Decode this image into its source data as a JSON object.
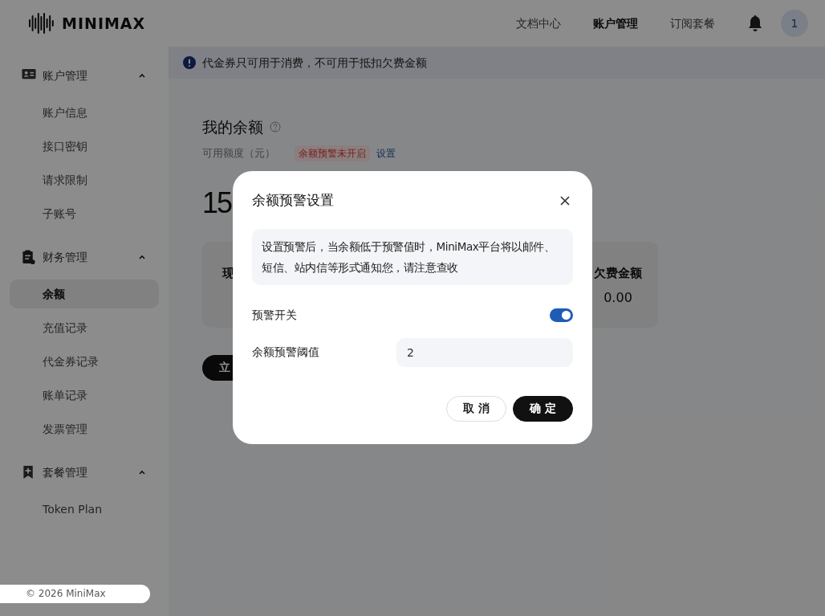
{
  "header": {
    "logo": "MINIMAX",
    "nav": [
      {
        "label": "文档中心",
        "selected": false
      },
      {
        "label": "账户管理",
        "selected": true
      },
      {
        "label": "订阅套餐",
        "selected": false
      }
    ],
    "avatar": "1"
  },
  "notice": {
    "text": "代金券只可用于消费，不可用于抵扣欠费金额"
  },
  "sidebar": {
    "groups": [
      {
        "label": "账户管理",
        "kind": "account",
        "expanded": true,
        "children": [
          {
            "label": "账户信息",
            "selected": false
          },
          {
            "label": "接口密钥",
            "selected": false
          },
          {
            "label": "请求限制",
            "selected": false
          },
          {
            "label": "子账号",
            "selected": false
          }
        ]
      },
      {
        "label": "财务管理",
        "kind": "finance",
        "expanded": true,
        "children": [
          {
            "label": "余额",
            "selected": true
          },
          {
            "label": "充值记录",
            "selected": false
          },
          {
            "label": "代金券记录",
            "selected": false
          },
          {
            "label": "账单记录",
            "selected": false
          },
          {
            "label": "发票管理",
            "selected": false
          }
        ]
      },
      {
        "label": "套餐管理",
        "kind": "plan",
        "expanded": true,
        "children": [
          {
            "label": "Token Plan",
            "selected": false
          }
        ]
      }
    ],
    "footer": "© 2026 MiniMax"
  },
  "balance": {
    "title": "我的余额",
    "subtitle": "可用额度（元）",
    "alert_tag": "余额预警未开启",
    "settings_link": "设置",
    "amount": "15",
    "cards": [
      {
        "label": "现"
      },
      {
        "label": "欠费金额",
        "value": "0.00"
      }
    ],
    "button": "立"
  },
  "dialog": {
    "title": "余额预警设置",
    "info": "设置预警后，当余额低于预警值时，MiniMax平台将以邮件、短信、站内信等形式通知您，请注意查收",
    "toggle": {
      "label": "预警开关",
      "on": true
    },
    "threshold": {
      "label": "余额预警阈值",
      "value": "2"
    },
    "buttons": [
      {
        "label": "取 消",
        "kind": "secondary"
      },
      {
        "label": "确 定",
        "kind": "primary"
      }
    ]
  }
}
